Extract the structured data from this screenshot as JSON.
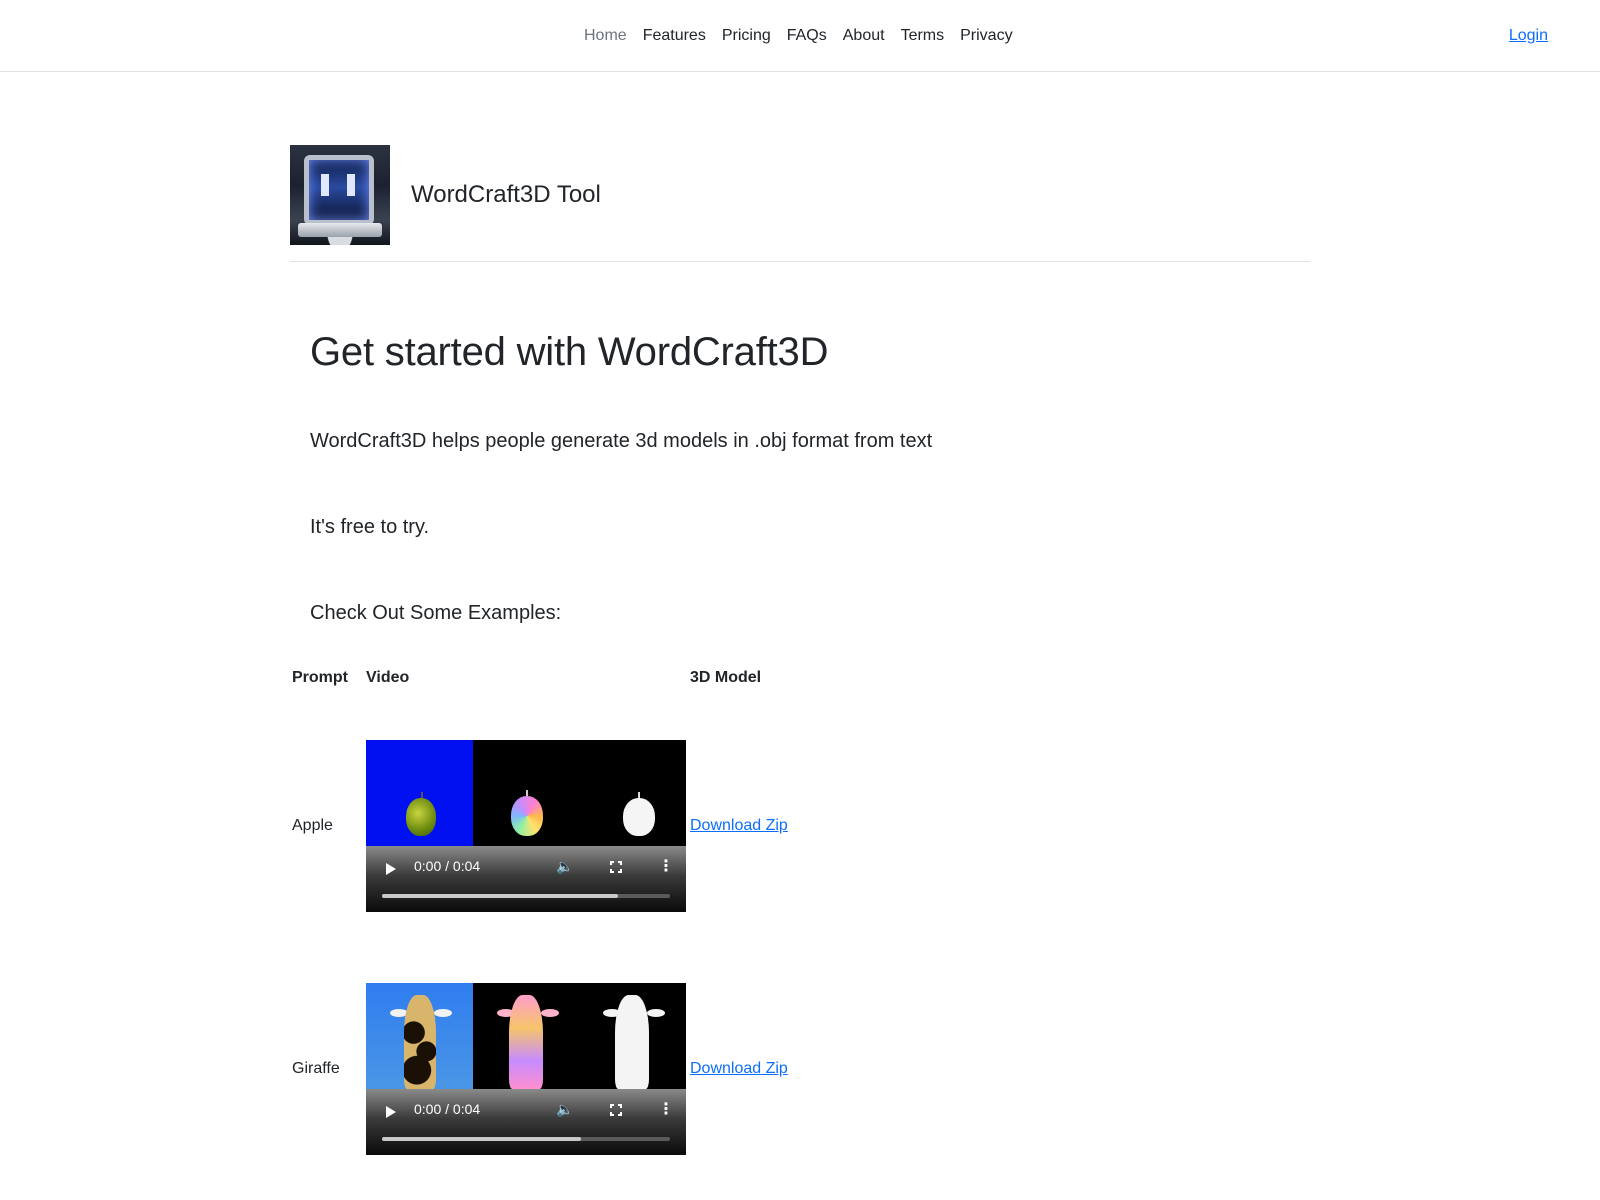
{
  "nav": {
    "links": [
      {
        "label": "Home",
        "active": true
      },
      {
        "label": "Features"
      },
      {
        "label": "Pricing"
      },
      {
        "label": "FAQs"
      },
      {
        "label": "About"
      },
      {
        "label": "Terms"
      },
      {
        "label": "Privacy"
      }
    ],
    "login_label": "Login"
  },
  "brand": {
    "logo": "3d-printer-image",
    "name": "WordCraft3D Tool"
  },
  "hero": {
    "title": "Get started with WordCraft3D",
    "description": "WordCraft3D helps people generate 3d models in .obj format from text",
    "free_note": "It's free to try.",
    "examples_heading": "Check Out Some Examples:"
  },
  "examples_table": {
    "headers": [
      "Prompt",
      "Video",
      "3D Model"
    ],
    "rows": [
      {
        "prompt": "Apple",
        "video": {
          "time": "0:00 / 0:04",
          "progress_fraction": 0.82,
          "icons": [
            "play-icon",
            "volume-icon",
            "fullscreen-icon",
            "more-options-icon"
          ]
        },
        "model_link": "Download Zip"
      },
      {
        "prompt": "Giraffe",
        "video": {
          "time": "0:00 / 0:04",
          "progress_fraction": 0.69,
          "icons": [
            "play-icon",
            "volume-icon",
            "fullscreen-icon",
            "more-options-icon"
          ]
        },
        "model_link": "Download Zip"
      }
    ]
  },
  "colors": {
    "link": "#0d6efd",
    "text": "#212529",
    "muted": "#6c757d",
    "border": "#dee2e6"
  }
}
